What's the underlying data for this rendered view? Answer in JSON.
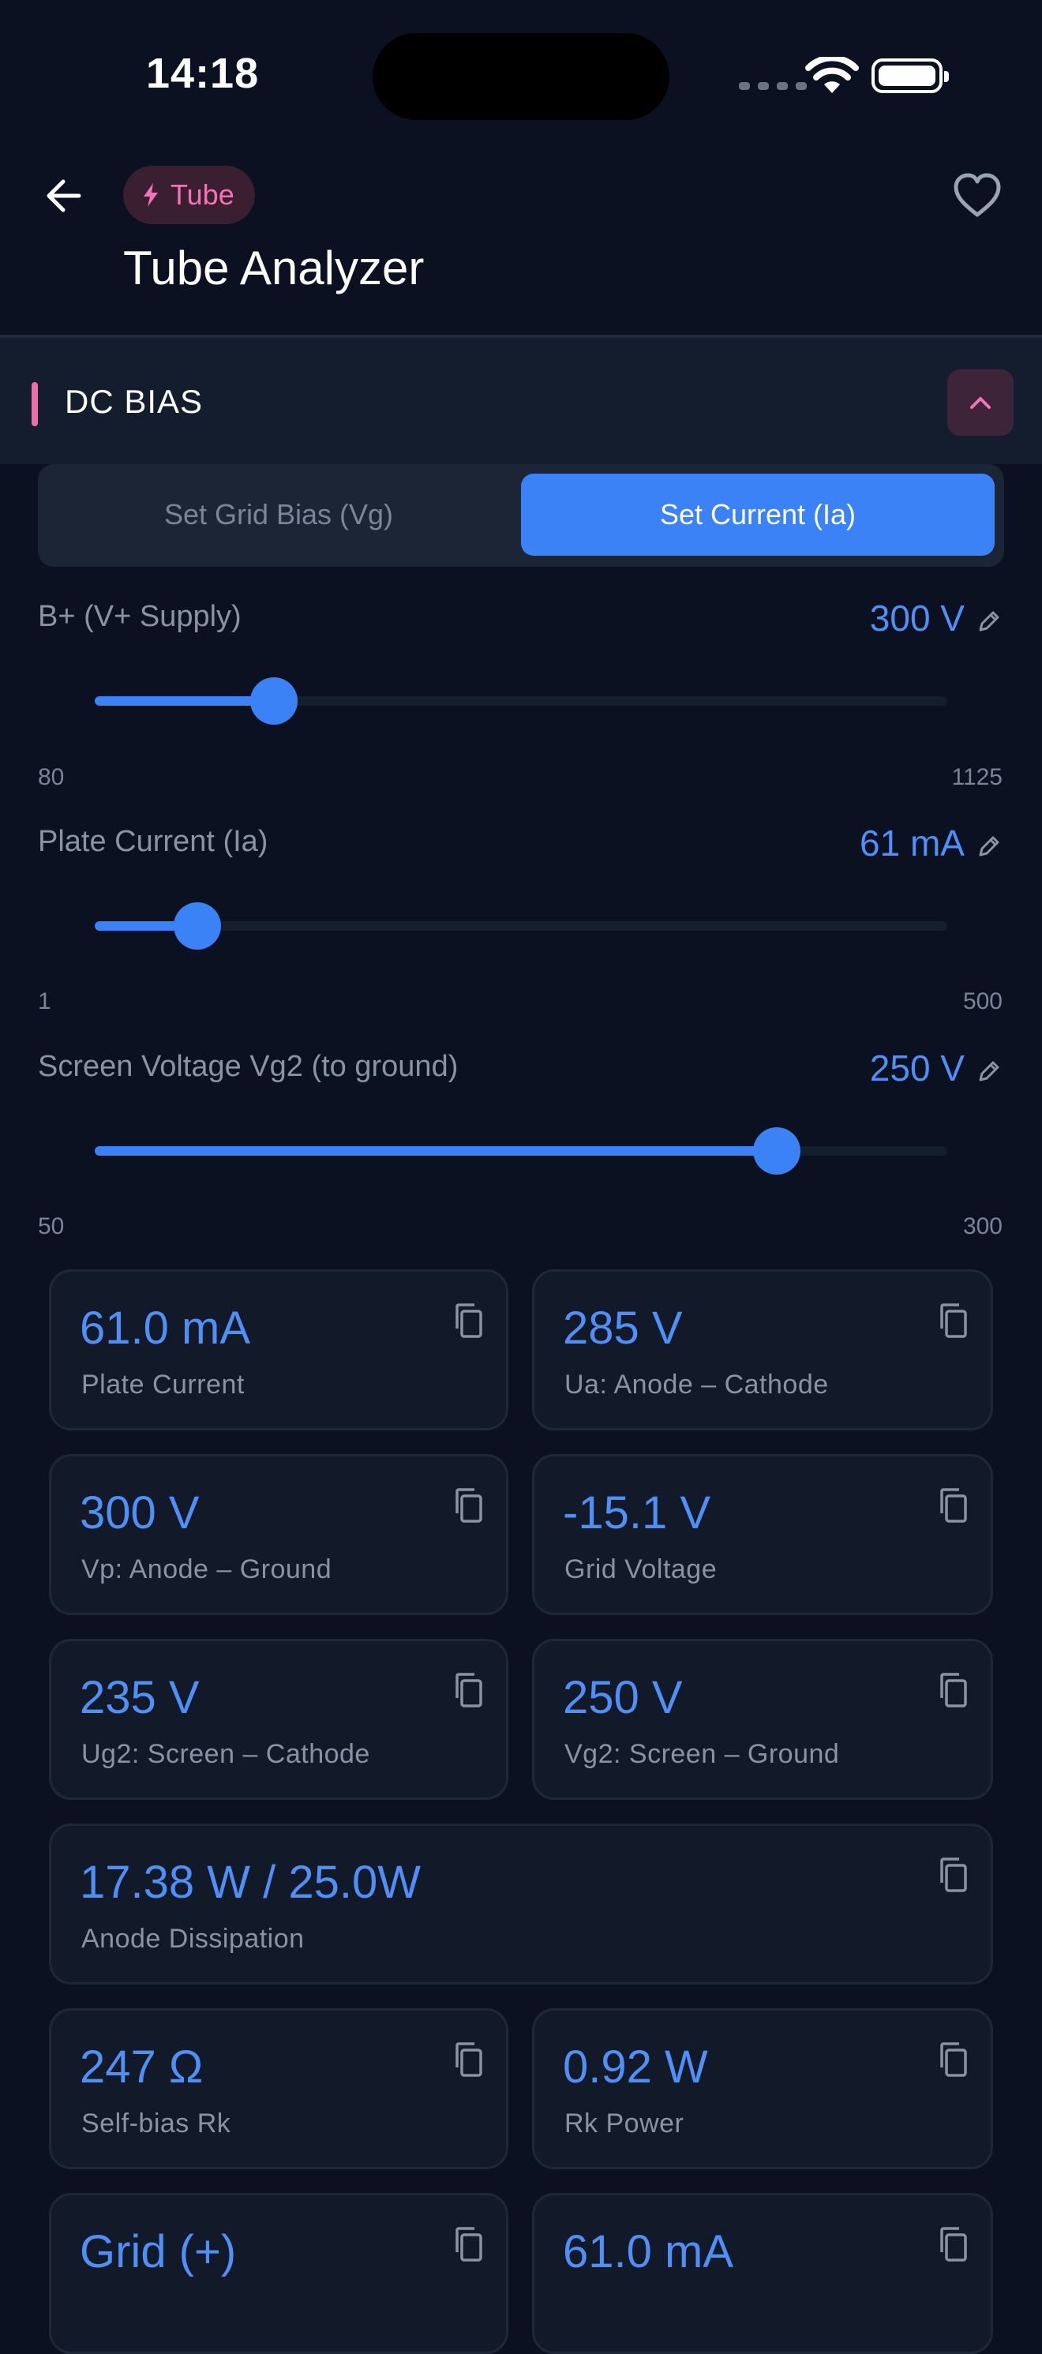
{
  "status_bar": {
    "time": "14:18"
  },
  "header": {
    "tag_label": "Tube",
    "title": "Tube Analyzer"
  },
  "section": {
    "title": "DC BIAS"
  },
  "mode_toggle": {
    "options": [
      "Set Grid Bias (Vg)",
      "Set Current (Ia)"
    ],
    "selected": "Set Current (Ia)"
  },
  "sliders": [
    {
      "label": "B+ (V+ Supply)",
      "value_text": "300 V",
      "min": "80",
      "max": "1125",
      "value": 300,
      "min_value": 80,
      "max_value": 1125
    },
    {
      "label": "Plate Current (Ia)",
      "value_text": "61 mA",
      "min": "1",
      "max": "500",
      "value": 61,
      "min_value": 1,
      "max_value": 500
    },
    {
      "label": "Screen Voltage Vg2 (to ground)",
      "value_text": "250 V",
      "min": "50",
      "max": "300",
      "value": 250,
      "min_value": 50,
      "max_value": 300
    }
  ],
  "results": [
    {
      "value": "61.0 mA",
      "label": "Plate Current"
    },
    {
      "value": "285 V",
      "label": "Ua: Anode – Cathode"
    },
    {
      "value": "300 V",
      "label": "Vp: Anode – Ground"
    },
    {
      "value": "-15.1 V",
      "label": "Grid Voltage"
    },
    {
      "value": "235 V",
      "label": "Ug2: Screen – Cathode"
    },
    {
      "value": "250 V",
      "label": "Vg2: Screen – Ground"
    },
    {
      "value": "17.38 W / 25.0W",
      "label": "Anode Dissipation"
    },
    {
      "value": "247 Ω",
      "label": "Self-bias Rk"
    },
    {
      "value": "0.92 W",
      "label": "Rk Power"
    },
    {
      "value": "Grid (+)",
      "label": ""
    },
    {
      "value": "61.0 mA",
      "label": ""
    }
  ],
  "colors": {
    "background": "#0b1120",
    "accent_blue": "#3b82f6",
    "accent_pink": "#ec6fa8",
    "card_bg": "#121a29"
  }
}
